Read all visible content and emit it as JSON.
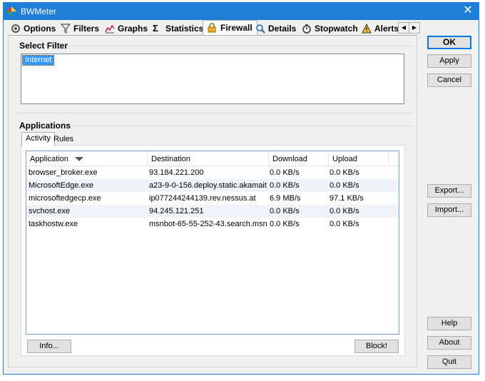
{
  "window": {
    "title": "BWMeter",
    "close_glyph": "✕"
  },
  "tabs": [
    {
      "label": "Options",
      "icon": "options-icon"
    },
    {
      "label": "Filters",
      "icon": "filter-funnel-icon"
    },
    {
      "label": "Graphs",
      "icon": "graphs-icon"
    },
    {
      "label": "Statistics",
      "icon": "sigma-icon"
    },
    {
      "label": "Firewall",
      "icon": "firewall-lock-icon",
      "active": true
    },
    {
      "label": "Details",
      "icon": "magnifier-icon"
    },
    {
      "label": "Stopwatch",
      "icon": "stopwatch-icon"
    },
    {
      "label": "Alerts",
      "icon": "warning-icon"
    }
  ],
  "tab_scroll": {
    "left": "◀",
    "right": "▶"
  },
  "select_filter": {
    "title": "Select Filter",
    "items": [
      "Internet"
    ],
    "selected": "Internet"
  },
  "applications": {
    "title": "Applications",
    "subtabs": [
      {
        "label": "Activity",
        "active": true
      },
      {
        "label": "Rules"
      }
    ],
    "columns": [
      "Application",
      "Destination",
      "Download",
      "Upload"
    ],
    "sorted_column": "Application",
    "rows": [
      {
        "application": "browser_broker.exe",
        "destination": "93.184.221.200",
        "download": "0.0 KB/s",
        "upload": "0.0 KB/s"
      },
      {
        "application": "MicrosoftEdge.exe",
        "destination": "a23-9-0-156.deploy.static.akamait...",
        "download": "0.0 KB/s",
        "upload": "0.0 KB/s"
      },
      {
        "application": "microsoftedgecp.exe",
        "destination": "ip077244244139.rev.nessus.at",
        "download": "6.9 MB/s",
        "upload": "97.1 KB/s"
      },
      {
        "application": "svchost.exe",
        "destination": "94.245.121.251",
        "download": "0.0 KB/s",
        "upload": "0.0 KB/s"
      },
      {
        "application": "taskhostw.exe",
        "destination": "msnbot-65-55-252-43.search.msn....",
        "download": "0.0 KB/s",
        "upload": "0.0 KB/s"
      }
    ],
    "info_button": "Info...",
    "block_button": "Block!"
  },
  "side_buttons": {
    "ok": "OK",
    "apply": "Apply",
    "cancel": "Cancel",
    "export": "Export...",
    "import": "Import...",
    "help": "Help",
    "about": "About",
    "quit": "Quit"
  }
}
